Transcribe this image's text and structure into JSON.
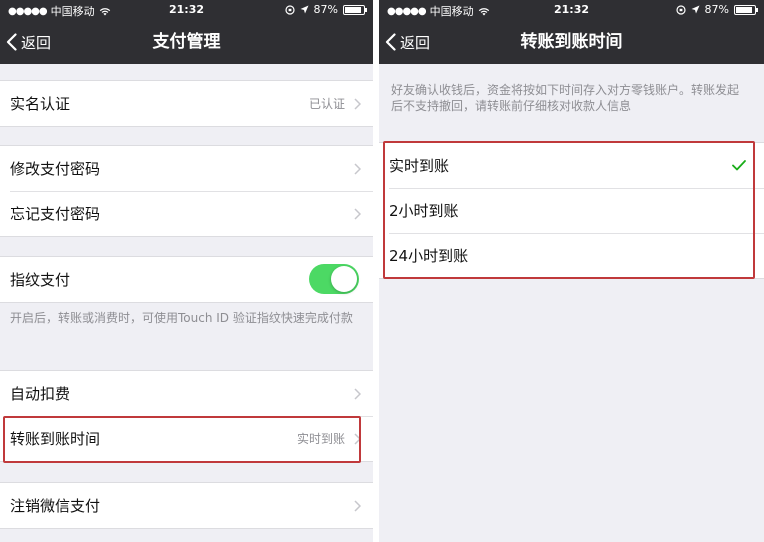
{
  "status": {
    "carrier": "中国移动",
    "time": "21:32",
    "battery": "87%"
  },
  "left": {
    "back_label": "返回",
    "title": "支付管理",
    "realname": {
      "label": "实名认证",
      "value": "已认证"
    },
    "change_password": "修改支付密码",
    "forgot_password": "忘记支付密码",
    "fingerprint": {
      "label": "指纹支付",
      "enabled": true
    },
    "fingerprint_note": "开启后，转账或消费时，可使用Touch ID 验证指纹快速完成付款",
    "auto_deduct": "自动扣费",
    "transfer_time": {
      "label": "转账到账时间",
      "value": "实时到账"
    },
    "cancel_wechat_pay": "注销微信支付"
  },
  "right": {
    "back_label": "返回",
    "title": "转账到账时间",
    "note": "好友确认收钱后，资金将按如下时间存入对方零钱账户。转账发起后不支持撤回，请转账前仔细核对收款人信息",
    "options": [
      {
        "label": "实时到账",
        "selected": true
      },
      {
        "label": "2小时到账",
        "selected": false
      },
      {
        "label": "24小时到账",
        "selected": false
      }
    ]
  },
  "colors": {
    "nav_background": "#2f2f33",
    "toggle_on": "#4cd964",
    "checkmark": "#1aad19",
    "highlight_border": "#c0393b"
  }
}
